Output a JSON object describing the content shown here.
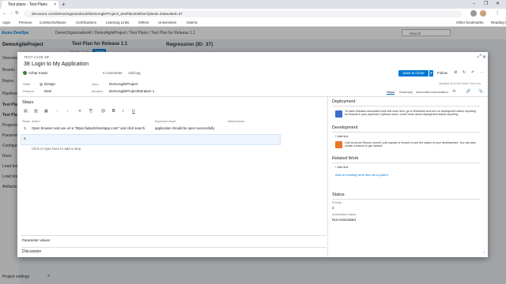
{
  "browser": {
    "tab_title": "Test plans - Test Plans",
    "tab_close": "×",
    "new_tab": "+",
    "window_controls": [
      "–",
      "❐",
      "✕"
    ],
    "url": "dev.azure.com/DemoOrganization4l/DemoAgileProject/_testPlans/define?planId=33&suiteId=37",
    "bookmarks": [
      "Apps",
      "Perseus",
      "ComburSoftware",
      "Certifications",
      "Learning Links",
      "Others",
      "Universities",
      "Islamic",
      "Other bookmarks",
      "Reading list"
    ]
  },
  "ado": {
    "logo": "Azure DevOps",
    "breadcrumbs": [
      "DemoOrganization4l",
      "/",
      "DemoAgileProject",
      "/",
      "Test Plans",
      "/",
      "Test Plan for Release 1.1"
    ],
    "search_placeholder": "Search",
    "project_name": "DemoAgileProject",
    "nav": [
      "Overview",
      "Boards",
      "Repos",
      "Pipelines",
      "Test Plans",
      "Test Plan",
      "Progress",
      "Parameters",
      "Configurations",
      "Runs",
      "Load test",
      "Load test",
      "Artifacts"
    ],
    "project_settings": "Project settings",
    "collapse": "«",
    "bg_plan_title": "Test Plan for Release 1.1",
    "bg_region_title": "Regression (ID: 37)",
    "bg_tag": "Current",
    "bg_date": "Oct 20 - Jul 5"
  },
  "dialog": {
    "type_label": "TEST CASE 38*",
    "id": "38",
    "title": "Login to My Application",
    "assigned": "Azhar Imam",
    "comments": "0 comments",
    "add_tag": "Add tag",
    "save_label": "Save & Close",
    "follow_label": "Follow",
    "updated_by": "Updated by Azhar Imam: Just now",
    "fields": {
      "state_label": "State",
      "state_value": "Design",
      "reason_label": "Reason",
      "reason_value": "New",
      "area_label": "Area",
      "area_value": "DemoAgileProject",
      "iteration_label": "Iteration",
      "iteration_value": "DemoAgileProject\\Iteration 1"
    },
    "tabs": [
      "Steps",
      "Summary",
      "Associated Automation"
    ],
    "steps": {
      "section": "Steps",
      "col_steps": "Steps",
      "col_action": "Action",
      "col_expected": "Expected result",
      "col_attachments": "Attachments",
      "row1_num": "1.",
      "row1_action": "Open browser and use url a \"https://adactinhotelapp.com/\" and click search",
      "row1_expected": "application should be open successfully",
      "row2_num": "2.",
      "add_step": "Click or type here to add a step"
    },
    "parameter_values": "Parameter values",
    "discussion": "Discussion",
    "deployment": {
      "section": "Deployment",
      "text": "To track releases associated with this work item, go to Releases and turn on deployment status reporting for Boards in your pipeline's Options menu. Learn more about deployment status reporting"
    },
    "development": {
      "section": "Development",
      "add_link": "Add link",
      "text": "Link an Azure Repos commit, pull request or branch to see the status of your development. You can also create a branch to get started."
    },
    "related": {
      "section": "Related Work",
      "add_link": "Add link",
      "add_existing": "Add an existing work item as a parent"
    },
    "status": {
      "section": "Status",
      "priority_label": "Priority",
      "priority_value": "2",
      "automation_label": "Automation status",
      "automation_value": "Not Automated"
    }
  },
  "colors": {
    "accent": "#0078d4",
    "deployment_icon": "#3b6fc4",
    "development_icon": "#e8752a",
    "state_dot": "#b2b2b2",
    "assigned_avatar": "#3a7d44"
  }
}
